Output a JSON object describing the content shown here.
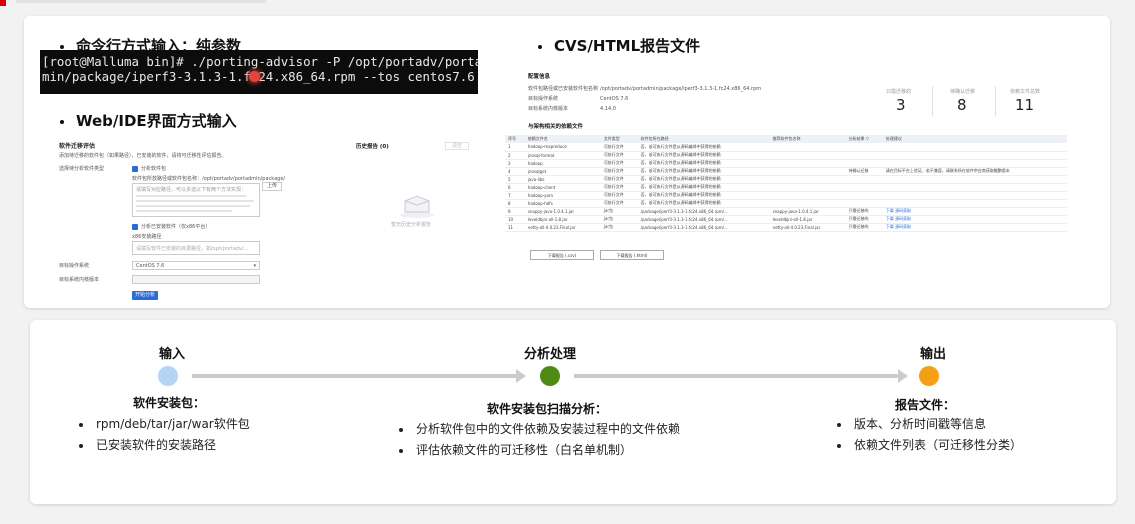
{
  "top": {
    "cli_title": "命令行方式输入：纯参数",
    "web_title": "Web/IDE界面方式输入",
    "report_title": "CVS/HTML报告文件",
    "terminal_line1": "[root@Malluma bin]# ./porting-advisor -P /opt/portadv/portad",
    "terminal_line2": "min/package/iperf3-3.1.3-1.fc24.x86_64.rpm --tos centos7.6"
  },
  "web_form": {
    "heading": "软件迁移评估",
    "subheading": "添加待迁移的软件包（如果路径），已安装的软件，请将可迁移性评估报告。",
    "type_label": "选择待分析软件类型",
    "option_pkg": "分析软件包",
    "path_label": "软件包所放路径或软件包名称：/opt/portadv/portadmin/package/",
    "textarea_hint": "请填写对应路径，可以多选以下有两个方法实现：",
    "upload_btn": "上传",
    "option_installed": "分析已安装软件（仅x86平台）",
    "installed_label": "x86安装路径",
    "installed_hint": "请填写软件已安装的目录路径，如/opt/portadv/...",
    "os_label": "目标操作系统",
    "os_value": "CentOS 7.6",
    "kernel_label": "目标系统内核版本",
    "kernel_value": "",
    "analyze_btn": "开始分析",
    "history_title": "历史报告 (0)",
    "history_btn": "清空",
    "history_empty": "暂无历史分析报告"
  },
  "report": {
    "config_title": "配置信息",
    "cfg1_label": "软件包路径或已安装软件包名称",
    "cfg1_value": "/opt/portadv/portadmin/package/iperf3-3.1.3-1.fc24.x86_64.rpm",
    "cfg2_label": "目标操作系统",
    "cfg2_value": "CentOS 7.6",
    "cfg3_label": "目标系统内核版本",
    "cfg3_value": "4.14.0",
    "stat1_label": "只需迁移的",
    "stat1_value": "3",
    "stat2_label": "待确认迁移",
    "stat2_value": "8",
    "stat3_label": "依赖文件总数",
    "stat3_value": "11",
    "table_title": "与架构相关的依赖文件",
    "headers": [
      "序号",
      "依赖文件名",
      "文件类型",
      "软件包所在路径",
      "推荐软件包名称",
      "分析结果",
      "处理建议"
    ],
    "rows": [
      [
        "1",
        "hadoop-mapreduce",
        "可执行文件",
        "否，该可执行文件是从源码编译中获得的依赖",
        "",
        "",
        ""
      ],
      [
        "2",
        "jnosql-format",
        "可执行文件",
        "否，该可执行文件是从源码编译中获得的依赖",
        "",
        "",
        ""
      ],
      [
        "3",
        "hadoop",
        "可执行文件",
        "否，该可执行文件是从源码编译中获得的依赖",
        "",
        "",
        ""
      ],
      [
        "4",
        "jnosqlget",
        "可执行文件",
        "否，该可执行文件是从源码编译中获得的依赖",
        "",
        "待确认迁移",
        "请在目标平台上验证，若不兼容，请联系所在软件供应商获取鲲鹏版本"
      ],
      [
        "5",
        "java-libs",
        "可执行文件",
        "否，该可执行文件是从源码编译中获得的依赖",
        "",
        "",
        ""
      ],
      [
        "6",
        "hadoop-client",
        "可执行文件",
        "否，该可执行文件是从源码编译中获得的依赖",
        "",
        "",
        ""
      ],
      [
        "7",
        "hadoop-yarn",
        "可执行文件",
        "否，该可执行文件是从源码编译中获得的依赖",
        "",
        "",
        ""
      ],
      [
        "8",
        "hadoop-hdfs",
        "可执行文件",
        "否，该可执行文件是从源码编译中获得的依赖",
        "",
        "",
        ""
      ],
      [
        "9",
        "snappy-java-1.0.4.1.jar",
        "jar包",
        "/package/iperf3-3.1.3-1.fc24.x86_64.rpm/...",
        "snappy-java-1.0.4.1.jar",
        "只需迁移的",
        "下载 源码获取"
      ],
      [
        "10",
        "leveldbjni-all-1.8.jar",
        "jar包",
        "/package/iperf3-3.1.3-1.fc24.x86_64.rpm/...",
        "leveldbjni-all-1.8.jar",
        "只需迁移的",
        "下载 源码获取"
      ],
      [
        "11",
        "netty-all-4.0.23.Final.jar",
        "jar包",
        "/package/iperf3-3.1.3-1.fc24.x86_64.rpm/...",
        "netty-all-4.0.23.Final.jar",
        "只需迁移的",
        "下载 源码获取"
      ]
    ],
    "dl_csv": "下载报告 (.csv)",
    "dl_html": "下载报告 (.html)"
  },
  "flow": {
    "input_title": "输入",
    "process_title": "分析处理",
    "output_title": "输出",
    "colors": {
      "input": "#b3d4f5",
      "process": "#4e8a14",
      "output": "#f5a014"
    },
    "input_sub": "软件安装包：",
    "input_items": [
      "rpm/deb/tar/jar/war软件包",
      "已安装软件的安装路径"
    ],
    "process_sub": "软件安装包扫描分析：",
    "process_items": [
      "分析软件包中的文件依赖及安装过程中的文件依赖",
      "评估依赖文件的可迁移性（白名单机制）"
    ],
    "output_sub": "报告文件：",
    "output_items": [
      "版本、分析时间戳等信息",
      "依赖文件列表（可迁移性分类）"
    ]
  }
}
